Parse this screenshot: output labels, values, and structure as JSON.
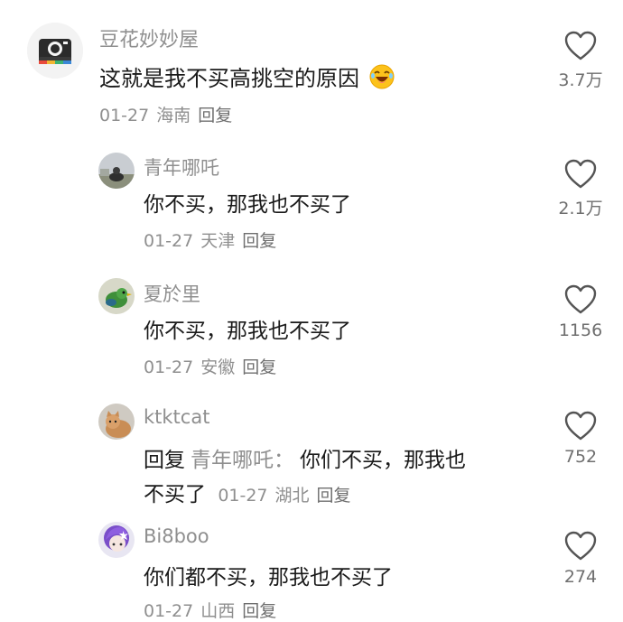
{
  "comments": [
    {
      "username": "豆花妙妙屋",
      "text": "这就是我不买高挑空的原因",
      "emoji": "laughing-emoji",
      "date": "01-27",
      "location": "海南",
      "reply_label": "回复",
      "likes": "3.7万",
      "avatar_icon": "camera-icon"
    },
    {
      "username": "青年哪吒",
      "text": "你不买，那我也不买了",
      "date": "01-27",
      "location": "天津",
      "reply_label": "回复",
      "likes": "2.1万",
      "avatar_icon": "photo-avatar"
    },
    {
      "username": "夏於里",
      "text": "你不买，那我也不买了",
      "date": "01-27",
      "location": "安徽",
      "reply_label": "回复",
      "likes": "1156",
      "avatar_icon": "bird-avatar"
    },
    {
      "username": "ktktcat",
      "reply_prefix": "回复",
      "reply_target": "青年哪吒：",
      "text_line1": "你们不买，那我也",
      "text_line2": "不买了",
      "date": "01-27",
      "location": "湖北",
      "reply_label": "回复",
      "likes": "752",
      "avatar_icon": "cat-avatar"
    },
    {
      "username": "Bi8boo",
      "text": "你们都不买，那我也不买了",
      "date": "01-27",
      "location": "山西",
      "reply_label": "回复",
      "likes": "274",
      "avatar_icon": "anime-avatar"
    }
  ]
}
